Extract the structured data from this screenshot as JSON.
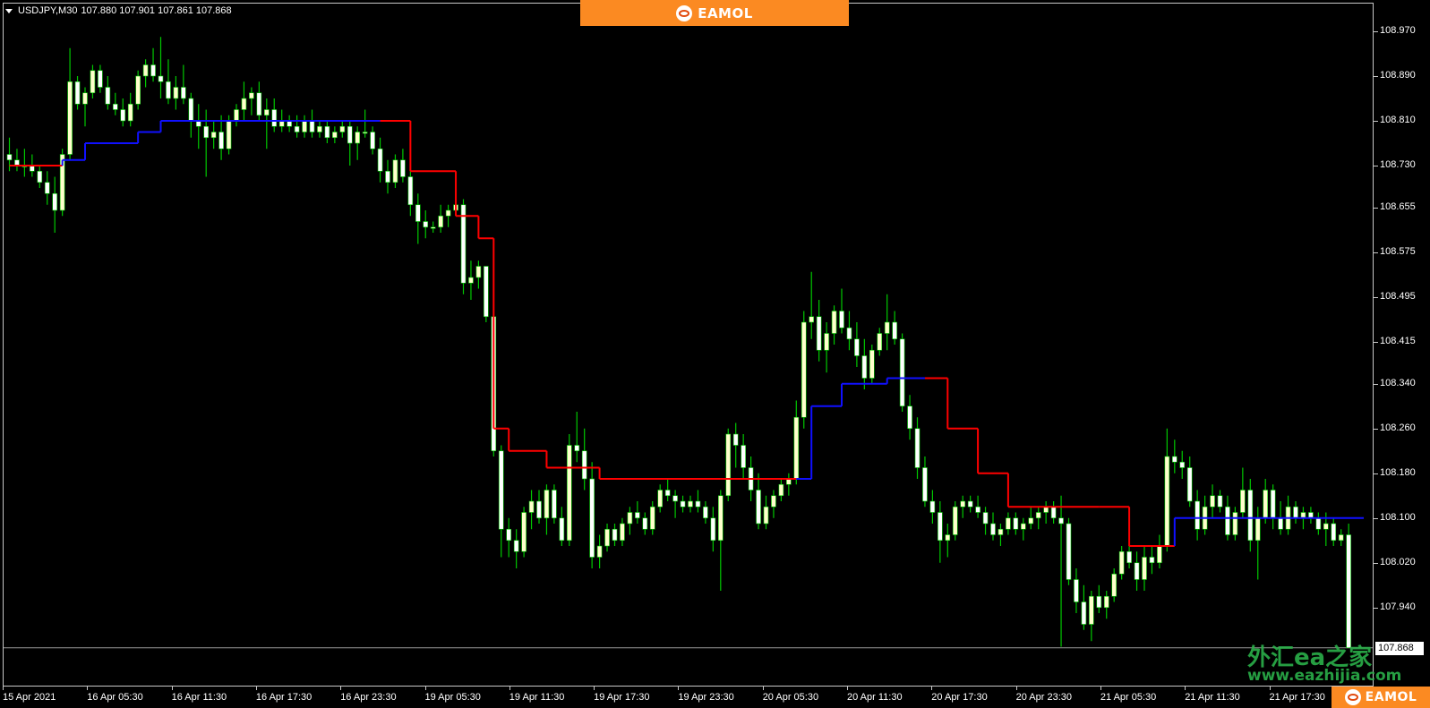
{
  "header": {
    "symbol": "USDJPY,M30",
    "ohlc": "107.880 107.901 107.861 107.868"
  },
  "brand": {
    "text": "EAMOL",
    "color": "#fb8a22"
  },
  "watermark": {
    "cn": "外汇ea之家",
    "url": "www.eazhijia.com"
  },
  "price_axis": {
    "labels": [
      "108.970",
      "108.890",
      "108.810",
      "108.730",
      "108.655",
      "108.575",
      "108.495",
      "108.415",
      "108.340",
      "108.260",
      "108.180",
      "108.100",
      "108.020",
      "107.940"
    ],
    "current_price": "107.868",
    "current_line_value": 107.868
  },
  "time_axis": {
    "labels": [
      "15 Apr 2021",
      "16 Apr 05:30",
      "16 Apr 11:30",
      "16 Apr 17:30",
      "16 Apr 23:30",
      "19 Apr 05:30",
      "19 Apr 11:30",
      "19 Apr 17:30",
      "19 Apr 23:30",
      "20 Apr 05:30",
      "20 Apr 11:30",
      "20 Apr 17:30",
      "20 Apr 23:30",
      "21 Apr 05:30",
      "21 Apr 11:30",
      "21 Apr 17:30"
    ]
  },
  "colors": {
    "background": "#000000",
    "bull": "#ffffcc",
    "bear": "#ffffff",
    "wick": "#00c800",
    "trend_down": "#ff0000",
    "trend_up": "#1010ff",
    "axis_text": "#ffffff"
  },
  "chart_data": {
    "type": "candlestick",
    "symbol": "USDJPY",
    "timeframe": "M30",
    "ylim": [
      107.868,
      109.0
    ],
    "candles": [
      [
        108.75,
        108.78,
        108.72,
        108.74
      ],
      [
        108.74,
        108.76,
        108.72,
        108.73
      ],
      [
        108.73,
        108.76,
        108.71,
        108.73
      ],
      [
        108.73,
        108.75,
        108.71,
        108.72
      ],
      [
        108.72,
        108.73,
        108.69,
        108.7
      ],
      [
        108.7,
        108.72,
        108.66,
        108.68
      ],
      [
        108.68,
        108.71,
        108.61,
        108.65
      ],
      [
        108.65,
        108.76,
        108.64,
        108.75
      ],
      [
        108.75,
        108.94,
        108.74,
        108.88
      ],
      [
        108.88,
        108.89,
        108.83,
        108.84
      ],
      [
        108.84,
        108.87,
        108.8,
        108.86
      ],
      [
        108.86,
        108.91,
        108.85,
        108.9
      ],
      [
        108.9,
        108.91,
        108.86,
        108.87
      ],
      [
        108.87,
        108.89,
        108.83,
        108.84
      ],
      [
        108.84,
        108.86,
        108.82,
        108.83
      ],
      [
        108.83,
        108.85,
        108.8,
        108.81
      ],
      [
        108.81,
        108.86,
        108.8,
        108.84
      ],
      [
        108.84,
        108.9,
        108.83,
        108.89
      ],
      [
        108.89,
        108.92,
        108.87,
        108.91
      ],
      [
        108.91,
        108.94,
        108.88,
        108.89
      ],
      [
        108.89,
        108.96,
        108.85,
        108.88
      ],
      [
        108.88,
        108.92,
        108.84,
        108.85
      ],
      [
        108.85,
        108.89,
        108.83,
        108.87
      ],
      [
        108.87,
        108.91,
        108.84,
        108.85
      ],
      [
        108.85,
        108.86,
        108.78,
        108.81
      ],
      [
        108.81,
        108.84,
        108.76,
        108.8
      ],
      [
        108.8,
        108.83,
        108.71,
        108.78
      ],
      [
        108.78,
        108.81,
        108.76,
        108.79
      ],
      [
        108.79,
        108.82,
        108.74,
        108.76
      ],
      [
        108.76,
        108.82,
        108.75,
        108.81
      ],
      [
        108.81,
        108.84,
        108.8,
        108.83
      ],
      [
        108.83,
        108.88,
        108.81,
        108.85
      ],
      [
        108.85,
        108.87,
        108.82,
        108.86
      ],
      [
        108.86,
        108.88,
        108.81,
        108.82
      ],
      [
        108.82,
        108.85,
        108.76,
        108.83
      ],
      [
        108.83,
        108.85,
        108.79,
        108.8
      ],
      [
        108.8,
        108.83,
        108.79,
        108.81
      ],
      [
        108.81,
        108.82,
        108.79,
        108.8
      ],
      [
        108.8,
        108.82,
        108.78,
        108.79
      ],
      [
        108.79,
        108.82,
        108.78,
        108.81
      ],
      [
        108.81,
        108.83,
        108.78,
        108.79
      ],
      [
        108.79,
        108.81,
        108.78,
        108.8
      ],
      [
        108.8,
        108.81,
        108.77,
        108.78
      ],
      [
        108.78,
        108.8,
        108.77,
        108.79
      ],
      [
        108.79,
        108.81,
        108.78,
        108.8
      ],
      [
        108.8,
        108.81,
        108.73,
        108.77
      ],
      [
        108.77,
        108.8,
        108.74,
        108.79
      ],
      [
        108.79,
        108.83,
        108.78,
        108.79
      ],
      [
        108.79,
        108.8,
        108.75,
        108.76
      ],
      [
        108.76,
        108.78,
        108.7,
        108.72
      ],
      [
        108.72,
        108.74,
        108.68,
        108.7
      ],
      [
        108.7,
        108.75,
        108.69,
        108.74
      ],
      [
        108.74,
        108.76,
        108.7,
        108.71
      ],
      [
        108.71,
        108.72,
        108.64,
        108.66
      ],
      [
        108.66,
        108.68,
        108.59,
        108.63
      ],
      [
        108.63,
        108.65,
        108.6,
        108.62
      ],
      [
        108.62,
        108.63,
        108.61,
        108.62
      ],
      [
        108.62,
        108.66,
        108.61,
        108.64
      ],
      [
        108.64,
        108.66,
        108.62,
        108.65
      ],
      [
        108.65,
        108.67,
        108.64,
        108.66
      ],
      [
        108.66,
        108.67,
        108.5,
        108.52
      ],
      [
        108.52,
        108.56,
        108.49,
        108.53
      ],
      [
        108.53,
        108.56,
        108.51,
        108.55
      ],
      [
        108.55,
        108.55,
        108.45,
        108.46
      ],
      [
        108.46,
        108.46,
        108.21,
        108.22
      ],
      [
        108.22,
        108.23,
        108.03,
        108.08
      ],
      [
        108.08,
        108.1,
        108.03,
        108.06
      ],
      [
        108.06,
        108.08,
        108.01,
        108.04
      ],
      [
        108.04,
        108.12,
        108.03,
        108.11
      ],
      [
        108.11,
        108.15,
        108.08,
        108.13
      ],
      [
        108.13,
        108.15,
        108.09,
        108.1
      ],
      [
        108.1,
        108.16,
        108.07,
        108.15
      ],
      [
        108.15,
        108.16,
        108.09,
        108.1
      ],
      [
        108.1,
        108.12,
        108.05,
        108.06
      ],
      [
        108.06,
        108.25,
        108.05,
        108.23
      ],
      [
        108.23,
        108.29,
        108.2,
        108.22
      ],
      [
        108.22,
        108.26,
        108.15,
        108.17
      ],
      [
        108.17,
        108.2,
        108.01,
        108.03
      ],
      [
        108.03,
        108.07,
        108.01,
        108.05
      ],
      [
        108.05,
        108.09,
        108.04,
        108.08
      ],
      [
        108.08,
        108.09,
        108.05,
        108.06
      ],
      [
        108.06,
        108.1,
        108.05,
        108.09
      ],
      [
        108.09,
        108.12,
        108.07,
        108.11
      ],
      [
        108.11,
        108.13,
        108.09,
        108.1
      ],
      [
        108.1,
        108.11,
        108.07,
        108.08
      ],
      [
        108.08,
        108.13,
        108.07,
        108.12
      ],
      [
        108.12,
        108.16,
        108.11,
        108.15
      ],
      [
        108.15,
        108.17,
        108.13,
        108.14
      ],
      [
        108.14,
        108.15,
        108.1,
        108.13
      ],
      [
        108.13,
        108.14,
        108.11,
        108.12
      ],
      [
        108.12,
        108.14,
        108.11,
        108.13
      ],
      [
        108.13,
        108.15,
        108.11,
        108.12
      ],
      [
        108.12,
        108.13,
        108.09,
        108.1
      ],
      [
        108.1,
        108.12,
        108.04,
        108.06
      ],
      [
        108.06,
        108.15,
        107.97,
        108.14
      ],
      [
        108.14,
        108.26,
        108.13,
        108.25
      ],
      [
        108.25,
        108.27,
        108.19,
        108.23
      ],
      [
        108.23,
        108.25,
        108.17,
        108.19
      ],
      [
        108.19,
        108.21,
        108.13,
        108.15
      ],
      [
        108.15,
        108.18,
        108.08,
        108.09
      ],
      [
        108.09,
        108.14,
        108.08,
        108.12
      ],
      [
        108.12,
        108.15,
        108.1,
        108.14
      ],
      [
        108.14,
        108.17,
        108.13,
        108.16
      ],
      [
        108.16,
        108.18,
        108.14,
        108.17
      ],
      [
        108.17,
        108.31,
        108.16,
        108.28
      ],
      [
        108.28,
        108.47,
        108.26,
        108.45
      ],
      [
        108.45,
        108.54,
        108.42,
        108.46
      ],
      [
        108.46,
        108.49,
        108.38,
        108.4
      ],
      [
        108.4,
        108.45,
        108.36,
        108.43
      ],
      [
        108.43,
        108.48,
        108.41,
        108.47
      ],
      [
        108.47,
        108.51,
        108.43,
        108.44
      ],
      [
        108.44,
        108.47,
        108.4,
        108.42
      ],
      [
        108.42,
        108.45,
        108.37,
        108.39
      ],
      [
        108.39,
        108.42,
        108.33,
        108.35
      ],
      [
        108.35,
        108.41,
        108.34,
        108.4
      ],
      [
        108.4,
        108.44,
        108.39,
        108.43
      ],
      [
        108.43,
        108.5,
        108.4,
        108.45
      ],
      [
        108.45,
        108.47,
        108.41,
        108.42
      ],
      [
        108.42,
        108.43,
        108.29,
        108.3
      ],
      [
        108.3,
        108.32,
        108.24,
        108.26
      ],
      [
        108.26,
        108.28,
        108.17,
        108.19
      ],
      [
        108.19,
        108.21,
        108.12,
        108.13
      ],
      [
        108.13,
        108.15,
        108.09,
        108.11
      ],
      [
        108.11,
        108.13,
        108.02,
        108.06
      ],
      [
        108.06,
        108.09,
        108.03,
        108.07
      ],
      [
        108.07,
        108.13,
        108.06,
        108.12
      ],
      [
        108.12,
        108.14,
        108.1,
        108.13
      ],
      [
        108.13,
        108.14,
        108.11,
        108.12
      ],
      [
        108.12,
        108.14,
        108.1,
        108.11
      ],
      [
        108.11,
        108.12,
        108.07,
        108.09
      ],
      [
        108.09,
        108.11,
        108.06,
        108.07
      ],
      [
        108.07,
        108.09,
        108.05,
        108.08
      ],
      [
        108.08,
        108.11,
        108.07,
        108.1
      ],
      [
        108.1,
        108.11,
        108.07,
        108.08
      ],
      [
        108.08,
        108.1,
        108.06,
        108.09
      ],
      [
        108.09,
        108.12,
        108.08,
        108.1
      ],
      [
        108.1,
        108.12,
        108.08,
        108.11
      ],
      [
        108.11,
        108.13,
        108.09,
        108.12
      ],
      [
        108.12,
        108.13,
        108.09,
        108.1
      ],
      [
        108.1,
        108.14,
        107.87,
        108.09
      ],
      [
        108.09,
        108.1,
        107.98,
        107.99
      ],
      [
        107.99,
        108.01,
        107.93,
        107.95
      ],
      [
        107.95,
        107.98,
        107.9,
        107.91
      ],
      [
        107.91,
        107.97,
        107.88,
        107.96
      ],
      [
        107.96,
        107.98,
        107.93,
        107.94
      ],
      [
        107.94,
        107.97,
        107.92,
        107.96
      ],
      [
        107.96,
        108.01,
        107.95,
        108.0
      ],
      [
        108.0,
        108.05,
        107.99,
        108.04
      ],
      [
        108.04,
        108.06,
        108.01,
        108.02
      ],
      [
        108.02,
        108.04,
        107.97,
        107.99
      ],
      [
        107.99,
        108.05,
        107.97,
        108.03
      ],
      [
        108.03,
        108.05,
        108.0,
        108.02
      ],
      [
        108.02,
        108.07,
        108.01,
        108.05
      ],
      [
        108.05,
        108.26,
        108.04,
        108.21
      ],
      [
        108.21,
        108.24,
        108.18,
        108.2
      ],
      [
        108.2,
        108.22,
        108.17,
        108.19
      ],
      [
        108.19,
        108.21,
        108.12,
        108.13
      ],
      [
        108.13,
        108.15,
        108.06,
        108.08
      ],
      [
        108.08,
        108.14,
        108.07,
        108.12
      ],
      [
        108.12,
        108.16,
        108.1,
        108.14
      ],
      [
        108.14,
        108.15,
        108.11,
        108.12
      ],
      [
        108.12,
        108.14,
        108.06,
        108.07
      ],
      [
        108.07,
        108.12,
        108.06,
        108.11
      ],
      [
        108.11,
        108.19,
        108.1,
        108.15
      ],
      [
        108.15,
        108.17,
        108.04,
        108.06
      ],
      [
        108.06,
        108.12,
        107.99,
        108.1
      ],
      [
        108.1,
        108.17,
        108.09,
        108.15
      ],
      [
        108.15,
        108.16,
        108.08,
        108.1
      ],
      [
        108.1,
        108.13,
        108.07,
        108.08
      ],
      [
        108.08,
        108.14,
        108.07,
        108.12
      ],
      [
        108.12,
        108.13,
        108.09,
        108.1
      ],
      [
        108.1,
        108.12,
        108.08,
        108.11
      ],
      [
        108.11,
        108.12,
        108.09,
        108.1
      ],
      [
        108.1,
        108.11,
        108.07,
        108.08
      ],
      [
        108.08,
        108.11,
        108.05,
        108.09
      ],
      [
        108.09,
        108.1,
        108.05,
        108.06
      ],
      [
        108.06,
        108.08,
        108.05,
        108.07
      ],
      [
        108.07,
        108.09,
        107.88,
        107.868
      ]
    ],
    "trend_line": [
      {
        "from": 0,
        "to": 7,
        "value": 108.73,
        "dir": "down"
      },
      {
        "from": 7,
        "to": 10,
        "value": 108.74,
        "dir": "up"
      },
      {
        "from": 10,
        "to": 17,
        "value": 108.77,
        "dir": "up"
      },
      {
        "from": 17,
        "to": 20,
        "value": 108.79,
        "dir": "up"
      },
      {
        "from": 20,
        "to": 49,
        "value": 108.81,
        "dir": "up"
      },
      {
        "from": 49,
        "to": 53,
        "value": 108.81,
        "dir": "down"
      },
      {
        "from": 53,
        "to": 59,
        "value": 108.72,
        "dir": "down"
      },
      {
        "from": 59,
        "to": 62,
        "value": 108.64,
        "dir": "down"
      },
      {
        "from": 62,
        "to": 64,
        "value": 108.6,
        "dir": "down"
      },
      {
        "from": 64,
        "to": 66,
        "value": 108.26,
        "dir": "down"
      },
      {
        "from": 66,
        "to": 71,
        "value": 108.22,
        "dir": "down"
      },
      {
        "from": 71,
        "to": 78,
        "value": 108.19,
        "dir": "down"
      },
      {
        "from": 78,
        "to": 104,
        "value": 108.17,
        "dir": "down"
      },
      {
        "from": 104,
        "to": 106,
        "value": 108.17,
        "dir": "up"
      },
      {
        "from": 106,
        "to": 110,
        "value": 108.3,
        "dir": "up"
      },
      {
        "from": 110,
        "to": 116,
        "value": 108.34,
        "dir": "up"
      },
      {
        "from": 116,
        "to": 121,
        "value": 108.35,
        "dir": "up"
      },
      {
        "from": 121,
        "to": 124,
        "value": 108.35,
        "dir": "down"
      },
      {
        "from": 124,
        "to": 128,
        "value": 108.26,
        "dir": "down"
      },
      {
        "from": 128,
        "to": 132,
        "value": 108.18,
        "dir": "down"
      },
      {
        "from": 132,
        "to": 144,
        "value": 108.12,
        "dir": "down"
      },
      {
        "from": 144,
        "to": 148,
        "value": 108.12,
        "dir": "down"
      },
      {
        "from": 148,
        "to": 154,
        "value": 108.05,
        "dir": "down"
      },
      {
        "from": 154,
        "to": 179,
        "value": 108.1,
        "dir": "up"
      }
    ]
  }
}
